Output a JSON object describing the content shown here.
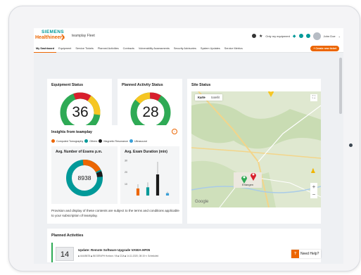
{
  "app": {
    "logo_line1": "SIEMENS",
    "logo_line2": "Healthineers",
    "title": "teamplay Fleet"
  },
  "top_right": {
    "my_equipment": "Only my equipment",
    "user": "John Doe"
  },
  "nav": {
    "items": [
      "My Dashboard",
      "Equipment",
      "Service Tickets",
      "Planned Activities",
      "Contracts",
      "Vulnerability Assessments",
      "Security Advisories",
      "System Updates",
      "Service Metrics"
    ],
    "create_button": "+ Create new ticket"
  },
  "equipment_status": {
    "title": "Equipment Status",
    "value": "36"
  },
  "planned_activity_status": {
    "title": "Planned Activity Status",
    "value": "28"
  },
  "site_status": {
    "title": "Site Status",
    "tabs": [
      "Karte",
      "Satellit"
    ],
    "city": "Erlangen",
    "google": "Google"
  },
  "insights": {
    "title": "Insights from teamplay",
    "legend": [
      "Computed Tomography",
      "Others",
      "Magnetic Resonance",
      "Ultrasound"
    ],
    "exams_card": {
      "title": "Avg. Number of Exams p.m.",
      "value": "8938"
    },
    "duration_card": {
      "title": "Avg. Exam Duration (min)"
    },
    "disclaimer": "Provision and display of these contents are subject to the terms and conditions applicable to your subscription of teamplay."
  },
  "chart_data": [
    {
      "type": "pie",
      "title": "Avg. Number of Exams p.m."
    },
    {
      "type": "bar",
      "title": "Avg. Exam Duration (min)",
      "ylim": [
        0,
        30
      ],
      "yticks": [
        "30",
        "20",
        "10"
      ],
      "series": [
        {
          "name": "Computed Tomography",
          "values": [
            6
          ]
        },
        {
          "name": "Others",
          "values": [
            7
          ]
        },
        {
          "name": "Magnetic Resonance",
          "values": [
            18
          ]
        },
        {
          "name": "Ultrasound",
          "values": [
            2
          ]
        }
      ]
    }
  ],
  "planned_activities": {
    "title": "Planned Activities",
    "item": {
      "date": "14",
      "title": "Update: Remote Software Upgrade VA50A-HF05",
      "meta": "■ 44445678  ◆ BIOGRAPH Horizon / M  ■ CDA  ■ 14.11.2020, 08:15  ↻ Scheduled"
    }
  },
  "help": {
    "label": "Need Help?"
  },
  "colors": {
    "brand_orange": "#ec6602",
    "brand_teal": "#009999",
    "green": "#2eaa55",
    "yellow": "#f6c623",
    "red": "#d81e2c"
  }
}
